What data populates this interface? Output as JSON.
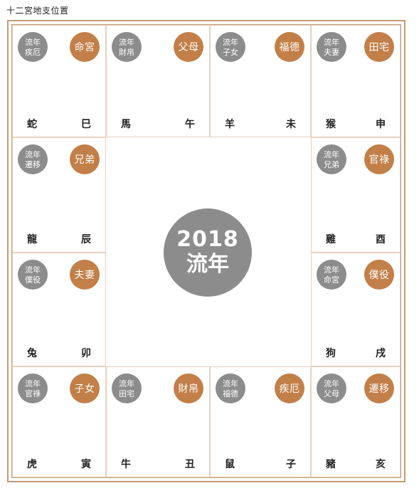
{
  "title": "十二宮地支位置",
  "center": {
    "year": "2018",
    "label": "流年"
  },
  "colors": {
    "border": "#c49a73",
    "gray_circle": "#8c8c8c",
    "orange_circle": "#c27f48"
  },
  "cells": [
    {
      "flow": "流年疾厄",
      "palace": "命宮",
      "left": "蛇",
      "right": "巳"
    },
    {
      "flow": "流年財帛",
      "palace": "父母",
      "left": "馬",
      "right": "午"
    },
    {
      "flow": "流年子女",
      "palace": "福德",
      "left": "羊",
      "right": "未"
    },
    {
      "flow": "流年夫妻",
      "palace": "田宅",
      "left": "猴",
      "right": "申"
    },
    {
      "flow": "流年遷移",
      "palace": "兄弟",
      "left": "龍",
      "right": "辰"
    },
    {
      "flow": "流年兄弟",
      "palace": "官祿",
      "left": "雞",
      "right": "酉"
    },
    {
      "flow": "流年僕役",
      "palace": "夫妻",
      "left": "兔",
      "right": "卯"
    },
    {
      "flow": "流年命宮",
      "palace": "僕役",
      "left": "狗",
      "right": "戌"
    },
    {
      "flow": "流年官祿",
      "palace": "子女",
      "left": "虎",
      "right": "寅"
    },
    {
      "flow": "流年田宅",
      "palace": "財帛",
      "left": "牛",
      "right": "丑"
    },
    {
      "flow": "流年福德",
      "palace": "疾厄",
      "left": "鼠",
      "right": "子"
    },
    {
      "flow": "流年父母",
      "palace": "遷移",
      "left": "豬",
      "right": "亥"
    }
  ]
}
